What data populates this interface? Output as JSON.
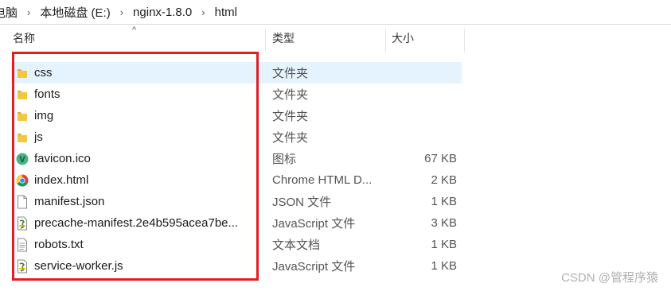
{
  "breadcrumb": {
    "items": [
      "电脑",
      "本地磁盘 (E:)",
      "nginx-1.8.0",
      "html"
    ],
    "separator": "›"
  },
  "columns": {
    "name": "名称",
    "type": "类型",
    "size": "大小",
    "sort_indicator": "^"
  },
  "files": [
    {
      "name": "css",
      "type": "文件夹",
      "size": "",
      "icon": "folder-icon",
      "selected": true
    },
    {
      "name": "fonts",
      "type": "文件夹",
      "size": "",
      "icon": "folder-icon"
    },
    {
      "name": "img",
      "type": "文件夹",
      "size": "",
      "icon": "folder-icon"
    },
    {
      "name": "js",
      "type": "文件夹",
      "size": "",
      "icon": "folder-icon"
    },
    {
      "name": "favicon.ico",
      "type": "图标",
      "size": "67 KB",
      "icon": "vue-logo-icon",
      "icon_letter": "V"
    },
    {
      "name": "index.html",
      "type": "Chrome HTML D...",
      "size": "2 KB",
      "icon": "chrome-icon"
    },
    {
      "name": "manifest.json",
      "type": "JSON 文件",
      "size": "1 KB",
      "icon": "blank-file-icon"
    },
    {
      "name": "precache-manifest.2e4b595acea7be...",
      "type": "JavaScript 文件",
      "size": "3 KB",
      "icon": "script-file-icon"
    },
    {
      "name": "robots.txt",
      "type": "文本文档",
      "size": "1 KB",
      "icon": "text-file-icon"
    },
    {
      "name": "service-worker.js",
      "type": "JavaScript 文件",
      "size": "1 KB",
      "icon": "script-file-icon"
    }
  ],
  "watermark": "CSDN @管程序猿",
  "colors": {
    "selection": "#e5f3ff",
    "highlight_border": "#e02020",
    "folder": "#f2c744",
    "vue_green": "#41b883"
  }
}
